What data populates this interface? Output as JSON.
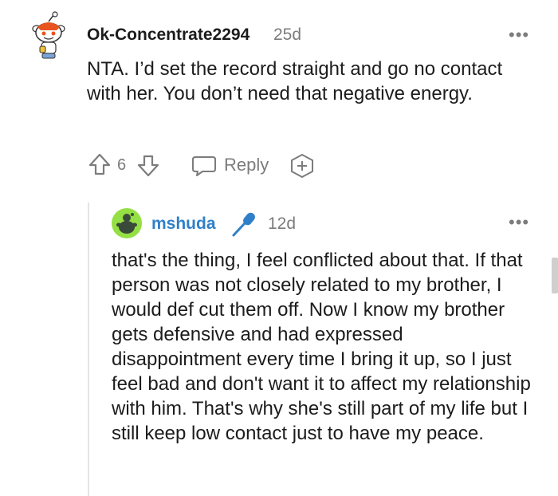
{
  "comments": [
    {
      "username": "Ok-Concentrate2294",
      "age": "25d",
      "text": "NTA. I’d set the record straight and go no contact with her. You don’t need that negative energy.",
      "votes": "6",
      "reply_label": "Reply",
      "more_label": "•••"
    },
    {
      "username": "mshuda",
      "age": "12d",
      "text": "that's the thing, I feel conflicted about that. If that person was not closely related to my brother, I would def cut them off. Now I know my brother gets defensive and had expressed disappointment every time I bring it up, so I just feel bad and don't want it to affect my relationship with him. That's why she's still part of my life but I still keep low contact just to have my peace.",
      "more_label": "•••",
      "username_color": "#2f80c8",
      "mic_icon": "microphone-icon"
    }
  ]
}
